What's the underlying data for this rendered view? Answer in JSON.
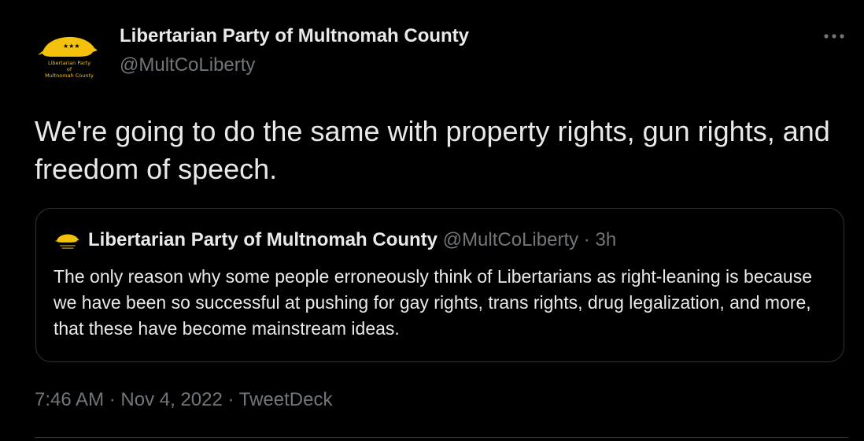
{
  "tweet": {
    "author_name": "Libertarian Party of Multnomah County",
    "author_handle": "@MultCoLiberty",
    "text": "We're going to do the same with property rights, gun rights, and freedom of speech.",
    "avatar": {
      "icon": "porcupine-logo-icon",
      "logo_text_line1": "Libertarian Party",
      "logo_text_line2": "of",
      "logo_text_line3": "Multnomah County",
      "logo_color": "#f4c20d"
    },
    "more_icon": "more-horizontal-icon"
  },
  "quoted_tweet": {
    "author_name": "Libertarian Party of Multnomah County",
    "author_handle": "@MultCoLiberty",
    "separator": "·",
    "time": "3h",
    "text": "The only reason why some people erroneously think of Libertarians as right-leaning is because we have been so successful at pushing for gay rights, trans rights, drug legalization, and more, that these have become mainstream ideas."
  },
  "meta": {
    "time": "7:46 AM",
    "separator": "·",
    "date": "Nov 4, 2022",
    "source": "TweetDeck"
  },
  "colors": {
    "background": "#000000",
    "primary_text": "#e7e9ea",
    "secondary_text": "#71767b",
    "border": "#2f3336",
    "logo_yellow": "#f4c20d"
  }
}
